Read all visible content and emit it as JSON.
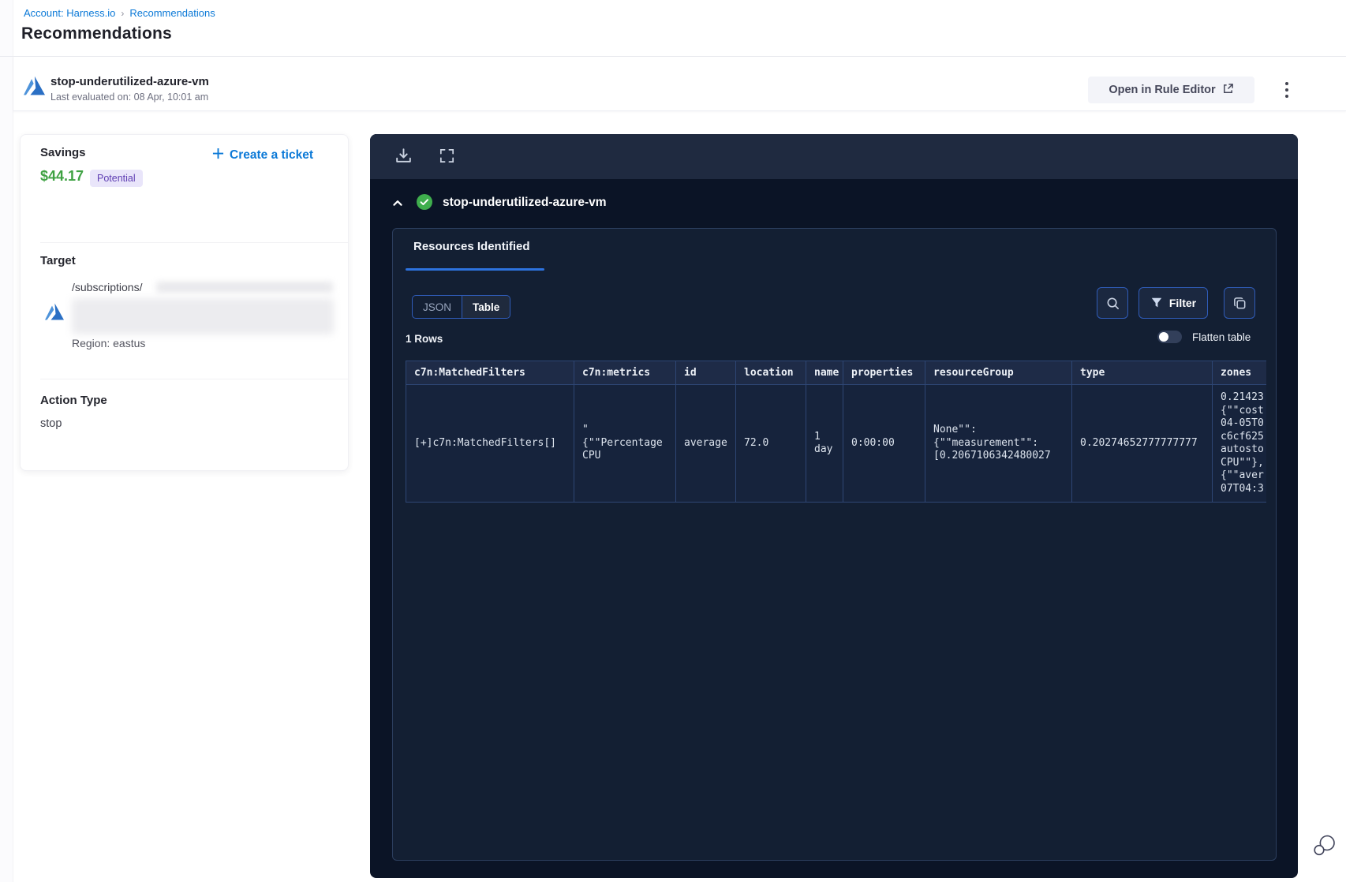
{
  "breadcrumb": {
    "account_link": "Account: Harness.io",
    "separator": "›",
    "current": "Recommendations"
  },
  "page_title": "Recommendations",
  "header": {
    "rule_name": "stop-underutilized-azure-vm",
    "last_evaluated": "Last evaluated on: 08 Apr, 10:01 am",
    "open_rule_editor": "Open in Rule Editor"
  },
  "details": {
    "savings_label": "Savings",
    "savings_amount": "$44.17",
    "savings_badge": "Potential",
    "create_ticket": "Create a ticket",
    "target_label": "Target",
    "target_path": "/subscriptions/",
    "region": "Region: eastus",
    "action_type_label": "Action Type",
    "action_type_value": "stop"
  },
  "panel": {
    "title": "stop-underutilized-azure-vm",
    "tab_label": "Resources Identified",
    "toggle_json": "JSON",
    "toggle_table": "Table",
    "selected_view": "Table",
    "filter_label": "Filter",
    "rows_count": "1 Rows",
    "flatten_label": "Flatten table",
    "flatten_on": false,
    "table": {
      "columns": [
        "c7n:MatchedFilters",
        "c7n:metrics",
        "id",
        "location",
        "name",
        "properties",
        "resourceGroup",
        "type",
        "zones"
      ],
      "row": {
        "matched_filters": "[+]c7n:MatchedFilters[]",
        "metrics": "\"\n{\"\"Percentage\nCPU",
        "id": "average",
        "location": "72.0",
        "name": "1\nday",
        "properties": "0:00:00",
        "resource_group": "None\"\":\n{\"\"measurement\"\":\n[0.2067106342480027",
        "type": "0.20274652777777777",
        "zones": "0.21423\n{\"\"cost\n04-05T0\nc6cf625\nautosto\nCPU\"\"},\n{\"\"aver\n07T04:3"
      }
    }
  },
  "colors": {
    "primary_blue": "#0b79d7",
    "savings_green": "#3fa243",
    "badge_bg": "#e9e5fa",
    "badge_text": "#5f3eb3",
    "tab_underline": "#2d72de",
    "panel_bg": "#0b1426",
    "panel_toolbar_bg": "#1f2a40",
    "table_border": "#2e4674",
    "table_link": "#7fb0e4",
    "check_green": "#3fae4d"
  }
}
